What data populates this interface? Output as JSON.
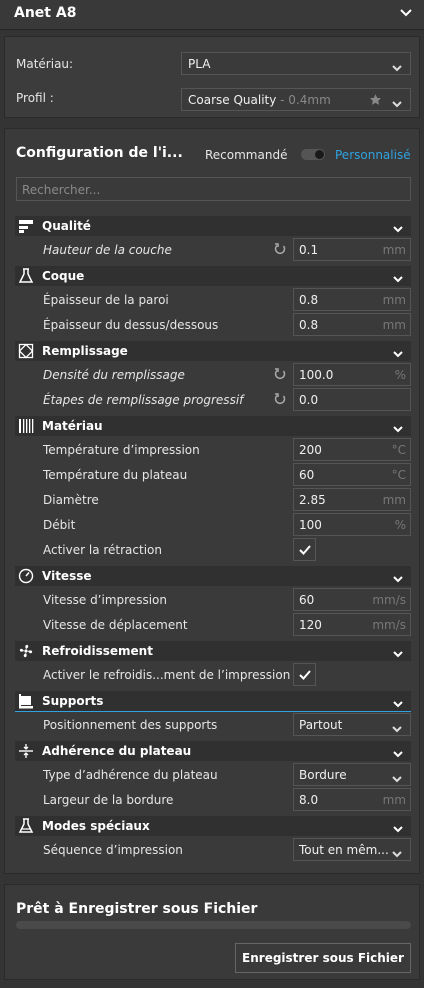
{
  "printer": {
    "name": "Anet A8"
  },
  "material_panel": {
    "material_label": "Matériau:",
    "material_value": "PLA",
    "profile_label": "Profil :",
    "profile_value": "Coarse Quality",
    "profile_suffix": " - 0.4mm"
  },
  "config": {
    "title": "Configuration de l'i...",
    "recommended": "Recommandé",
    "custom": "Personnalisé",
    "search_placeholder": "Rechercher..."
  },
  "categories": [
    {
      "label": "Qualité",
      "icon": "quality-icon"
    },
    {
      "label": "Coque",
      "icon": "shell-icon"
    },
    {
      "label": "Remplissage",
      "icon": "infill-icon"
    },
    {
      "label": "Matériau",
      "icon": "material-icon"
    },
    {
      "label": "Vitesse",
      "icon": "speed-icon"
    },
    {
      "label": "Refroidissement",
      "icon": "fan-icon"
    },
    {
      "label": "Supports",
      "icon": "support-icon"
    },
    {
      "label": "Adhérence du plateau",
      "icon": "adhesion-icon"
    },
    {
      "label": "Modes spéciaux",
      "icon": "special-modes-icon"
    }
  ],
  "settings": {
    "layer_height": {
      "label": "Hauteur de la couche",
      "value": "0.1",
      "unit": "mm"
    },
    "wall_thickness": {
      "label": "Épaisseur de la paroi",
      "value": "0.8",
      "unit": "mm"
    },
    "top_bottom_thickness": {
      "label": "Épaisseur du dessus/dessous",
      "value": "0.8",
      "unit": "mm"
    },
    "infill_density": {
      "label": "Densité du remplissage",
      "value": "100.0",
      "unit": "%"
    },
    "gradual_infill": {
      "label": "Étapes de remplissage progressif",
      "value": "0.0"
    },
    "print_temp": {
      "label": "Température d’impression",
      "value": "200",
      "unit": "°C"
    },
    "bed_temp": {
      "label": "Température du plateau",
      "value": "60",
      "unit": "°C"
    },
    "diameter": {
      "label": "Diamètre",
      "value": "2.85",
      "unit": "mm"
    },
    "flow": {
      "label": "Débit",
      "value": "100",
      "unit": "%"
    },
    "retraction": {
      "label": "Activer la rétraction",
      "checked": true
    },
    "print_speed": {
      "label": "Vitesse d’impression",
      "value": "60",
      "unit": "mm/s"
    },
    "travel_speed": {
      "label": "Vitesse de déplacement",
      "value": "120",
      "unit": "mm/s"
    },
    "cooling": {
      "label": "Activer le refroidis...ment de l’impression",
      "checked": true
    },
    "support_placement": {
      "label": "Positionnement des supports",
      "value": "Partout"
    },
    "adhesion_type": {
      "label": "Type d’adhérence du plateau",
      "value": "Bordure"
    },
    "brim_width": {
      "label": "Largeur de la bordure",
      "value": "8.0",
      "unit": "mm"
    },
    "print_sequence": {
      "label": "Séquence d’impression",
      "value": "Tout en mêm..."
    }
  },
  "footer": {
    "status": "Prêt à Enregistrer sous Fichier",
    "progress": 0,
    "save_button": "Enregistrer sous Fichier"
  },
  "colors": {
    "accent": "#2fa3e0",
    "panel": "#3a3a3a",
    "category_bar": "#303030"
  }
}
